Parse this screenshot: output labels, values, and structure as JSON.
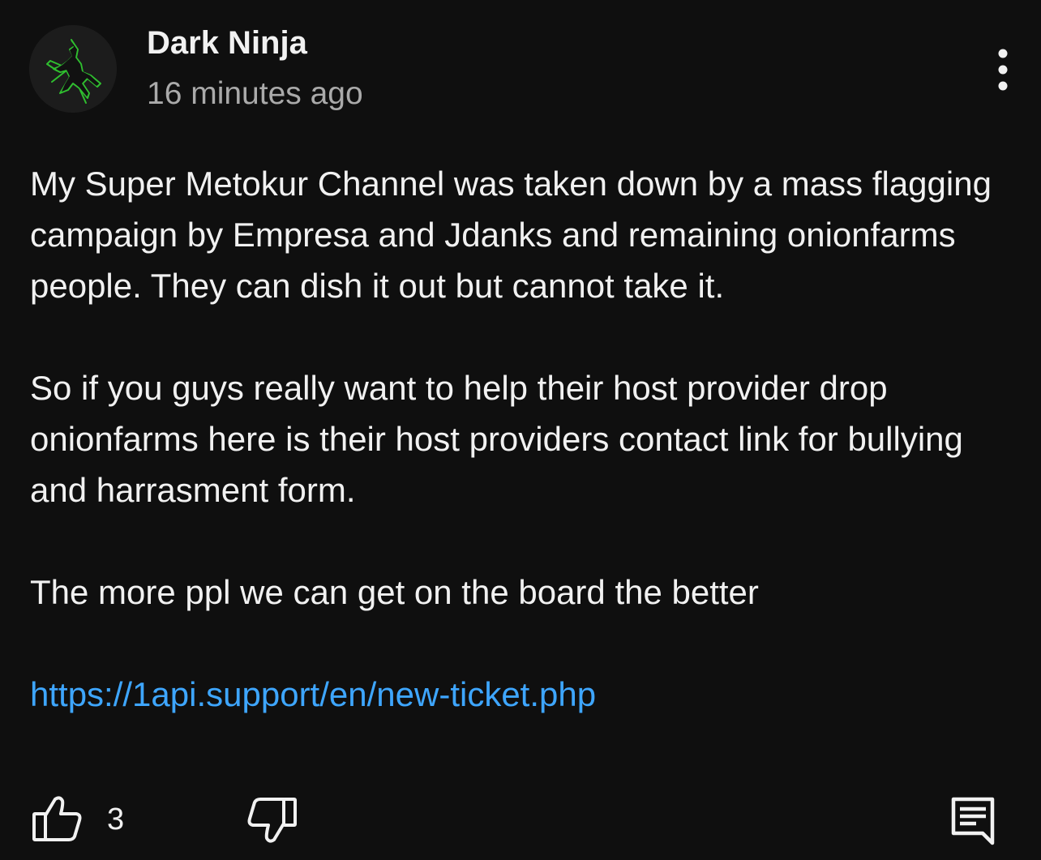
{
  "comment": {
    "author": "Dark Ninja",
    "timestamp": "16 minutes ago",
    "avatar_icon": "ninja-avatar-icon",
    "more_icon": "vertical-ellipsis-icon",
    "paragraphs": [
      "My Super Metokur Channel was taken down by a mass flagging campaign by Empresa and Jdanks and remaining onionfarms people. They can dish it out but cannot take it.",
      "So if you guys really want to help their host provider drop onionfarms here is their host providers contact link for bullying and harrasment form.",
      "The more ppl we can get on the board the better"
    ],
    "link": "https://1api.support/en/new-ticket.php",
    "link_color": "#3ea6ff"
  },
  "actions": {
    "like_icon": "thumbs-up-icon",
    "like_count": "3",
    "dislike_icon": "thumbs-down-icon",
    "reply_icon": "reply-comment-icon"
  },
  "colors": {
    "background": "#0f0f0f",
    "text": "#f1f1f1",
    "secondary_text": "#aaaaaa",
    "avatar_accent": "#2fbf2f"
  }
}
